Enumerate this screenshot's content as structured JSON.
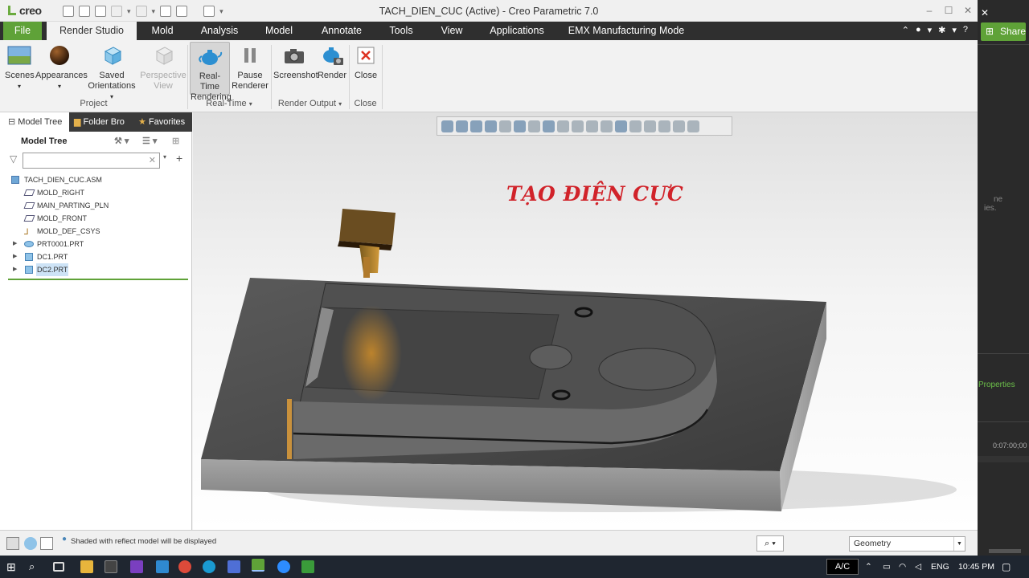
{
  "app": {
    "logo": "creo",
    "window_title": "TACH_DIEN_CUC (Active) - Creo Parametric 7.0"
  },
  "tabs": [
    "File",
    "Render Studio",
    "Mold",
    "Analysis",
    "Model",
    "Annotate",
    "Tools",
    "View",
    "Applications",
    "EMX Manufacturing Mode"
  ],
  "ribbon": {
    "scenes": "Scenes",
    "appearances": "Appearances",
    "saved_orientations_1": "Saved",
    "saved_orientations_2": "Orientations",
    "perspective_1": "Perspective",
    "perspective_2": "View",
    "realtime_1": "Real-Time",
    "realtime_2": "Rendering",
    "pause_1": "Pause",
    "pause_2": "Renderer",
    "screenshot": "Screenshot",
    "render": "Render",
    "close": "Close",
    "groups": {
      "project": "Project",
      "realtime": "Real-Time",
      "render_output": "Render Output",
      "close": "Close"
    }
  },
  "left_panel": {
    "tabs": [
      "Model Tree",
      "Folder Bro",
      "Favorites"
    ],
    "header": "Model Tree",
    "tree": [
      {
        "label": "TACH_DIEN_CUC.ASM",
        "icon": "assembly-icon"
      },
      {
        "label": "MOLD_RIGHT",
        "icon": "datum-plane-icon"
      },
      {
        "label": "MAIN_PARTING_PLN",
        "icon": "datum-plane-icon"
      },
      {
        "label": "MOLD_FRONT",
        "icon": "datum-plane-icon"
      },
      {
        "label": "MOLD_DEF_CSYS",
        "icon": "csys-icon"
      },
      {
        "label": "PRT0001.PRT",
        "icon": "part-icon"
      },
      {
        "label": "DC1.PRT",
        "icon": "part-icon"
      },
      {
        "label": "DC2.PRT",
        "icon": "part-icon"
      }
    ]
  },
  "viewport": {
    "overlay_title": "TẠO ĐIỆN CỰC"
  },
  "status": {
    "message": "Shaded with reflect model will be displayed",
    "filter": "Geometry"
  },
  "side_panel": {
    "share": "Share",
    "text1": "ne",
    "text2": "ies.",
    "properties": "Properties",
    "timecode": "0:07:00;00"
  },
  "taskbar": {
    "ac": "A/C",
    "lang": "ENG",
    "time": "10:45 PM"
  },
  "colors": {
    "accent_green": "#5fa238",
    "title_red": "#d1232a"
  }
}
